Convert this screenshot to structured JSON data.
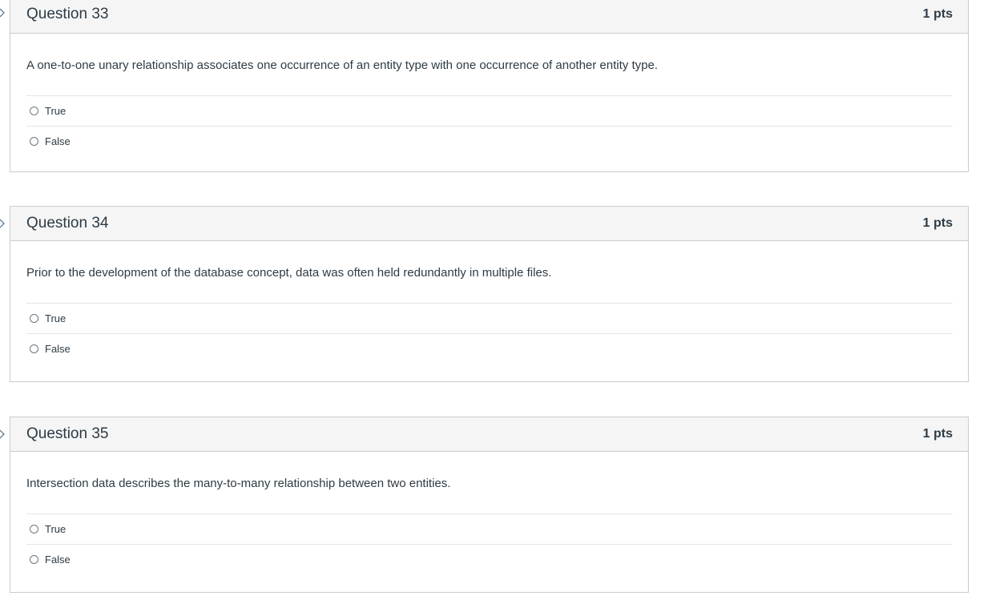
{
  "questions": [
    {
      "title": "Question 33",
      "points": "1 pts",
      "text": "A one-to-one unary relationship associates one occurrence of an entity type with one occurrence of another entity type.",
      "answers": [
        "True",
        "False"
      ]
    },
    {
      "title": "Question 34",
      "points": "1 pts",
      "text": "Prior to the development of the database concept, data was often held redundantly in multiple files.",
      "answers": [
        "True",
        "False"
      ]
    },
    {
      "title": "Question 35",
      "points": "1 pts",
      "text": "Intersection data describes the many-to-many relationship between two entities.",
      "answers": [
        "True",
        "False"
      ]
    }
  ],
  "colors": {
    "header_bg": "#f5f5f5",
    "border": "#c7cdd1",
    "text": "#2d3b45",
    "flag": "#2d3b45"
  }
}
